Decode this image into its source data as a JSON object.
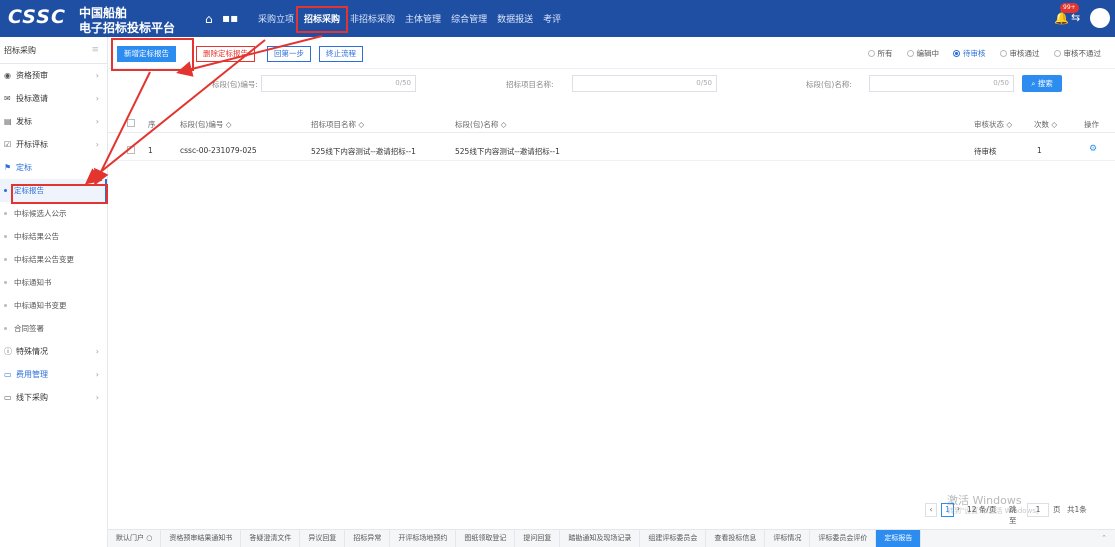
{
  "header": {
    "logo": "CSSC",
    "brand_line1": "中国船舶",
    "brand_line2": "电子招标投标平台",
    "nav": [
      "采购立项",
      "招标采购",
      "非招标采购",
      "主体管理",
      "综合管理",
      "数据报送",
      "考评"
    ],
    "active_nav": "招标采购",
    "badge": "99+"
  },
  "sidebar": {
    "title": "招标采购",
    "items": [
      {
        "label": "资格预审",
        "icon": "eye-icon",
        "chevron": true
      },
      {
        "label": "投标邀请",
        "icon": "mail-icon",
        "chevron": true
      },
      {
        "label": "发标",
        "icon": "doc-icon",
        "chevron": true
      },
      {
        "label": "开标评标",
        "icon": "check-icon",
        "chevron": true
      },
      {
        "label": "定标",
        "icon": "flag-icon",
        "chevron": false
      }
    ],
    "subitems": [
      "定标报告",
      "中标候选人公示",
      "中标结果公告",
      "中标结果公告变更",
      "中标通知书",
      "中标通知书变更",
      "合同签署"
    ],
    "items_after": [
      {
        "label": "特殊情况",
        "icon": "info-icon",
        "chevron": true
      },
      {
        "label": "费用管理",
        "icon": "folder-icon",
        "chevron": true
      },
      {
        "label": "线下采购",
        "icon": "folder-icon",
        "chevron": true
      }
    ]
  },
  "toolbar": {
    "add_report": "新增定标报告",
    "delete_report": "删除定标报告",
    "back_step": "回第一步",
    "terminate": "终止流程",
    "radios": [
      "所有",
      "编辑中",
      "待审核",
      "审核通过",
      "审核不通过"
    ],
    "radio_selected": "待审核"
  },
  "search": {
    "label_code": "标段(包)编号:",
    "label_project": "招标项目名称:",
    "label_name": "标段(包)名称:",
    "count": "0/50",
    "button": "搜索"
  },
  "table": {
    "headers": [
      "序",
      "标段(包)编号 ◇",
      "招标项目名称 ◇",
      "标段(包)名称 ◇",
      "审核状态 ◇",
      "次数 ◇",
      "操作"
    ],
    "rows": [
      {
        "index": "1",
        "code": "cssc-00-231079-025",
        "project": "525线下内容测试--邀请招标--1",
        "name": "525线下内容测试--邀请招标--1",
        "status": "待审核",
        "count": "1"
      }
    ]
  },
  "pager": {
    "page": "1",
    "per_page": "12 条/页",
    "jump": "跳至",
    "jump_page": "1",
    "page_suffix": "页",
    "total": "共1条"
  },
  "watermark": {
    "line1": "激活 Windows",
    "line2": "转到\"设置\"以激活 Windows。"
  },
  "bottom_tabs": [
    "默认门户",
    "资格预审结果通知书",
    "答疑澄清文件",
    "异议回复",
    "招标异常",
    "开评标场地预约",
    "图纸领取登记",
    "提问回复",
    "踏勘通知及现场记录",
    "组建评标委员会",
    "查看投标信息",
    "评标情况",
    "评标委员会评价",
    "定标报告"
  ],
  "bottom_active": "定标报告",
  "colors": {
    "header": "#1f4fa3",
    "primary": "#2d8cf0",
    "annotation": "#e3342f"
  }
}
